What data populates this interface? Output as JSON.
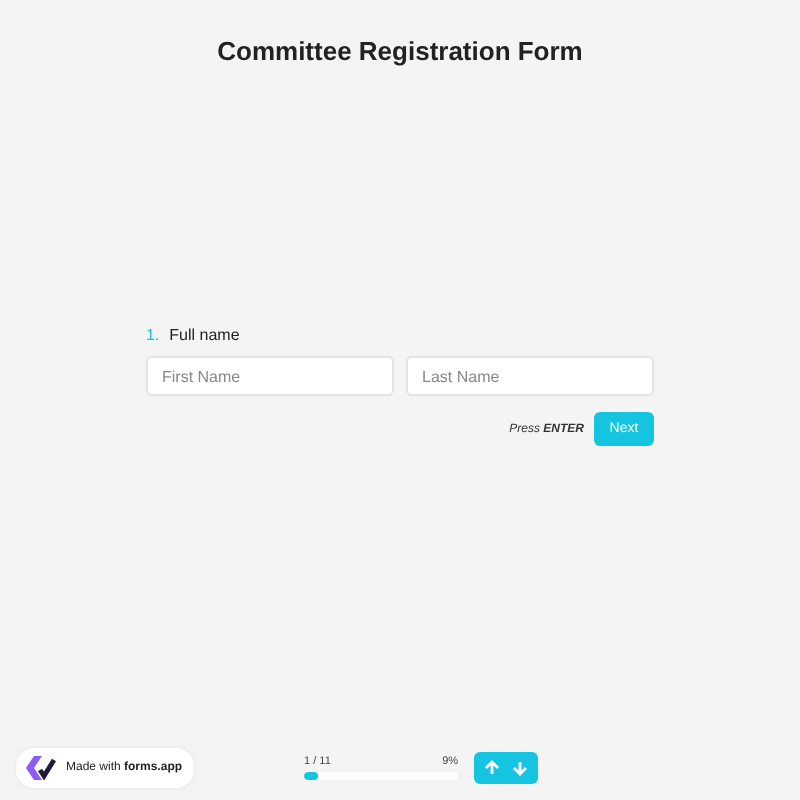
{
  "title": "Committee Registration Form",
  "question": {
    "number": "1.",
    "label": "Full name",
    "fields": [
      {
        "placeholder": "First Name"
      },
      {
        "placeholder": "Last Name"
      }
    ]
  },
  "hint": "Press **ENTER**",
  "next_button": "Next",
  "badge": "Made with **forms.app**",
  "progress": {
    "count": "1 / 11",
    "percent": "9%",
    "level": 0.09
  }
}
